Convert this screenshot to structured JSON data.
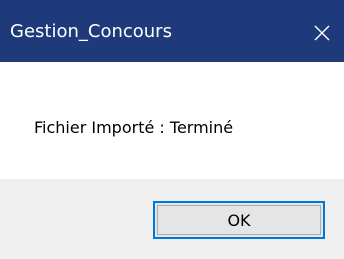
{
  "window": {
    "title": "Gestion_Concours",
    "close_icon": "close-icon"
  },
  "dialog": {
    "message": "Fichier Importé : Terminé",
    "ok_label": "OK"
  },
  "colors": {
    "titlebar": "#1f3a7a",
    "button_border": "#0078d7",
    "footer_bg": "#f0f0f0"
  }
}
